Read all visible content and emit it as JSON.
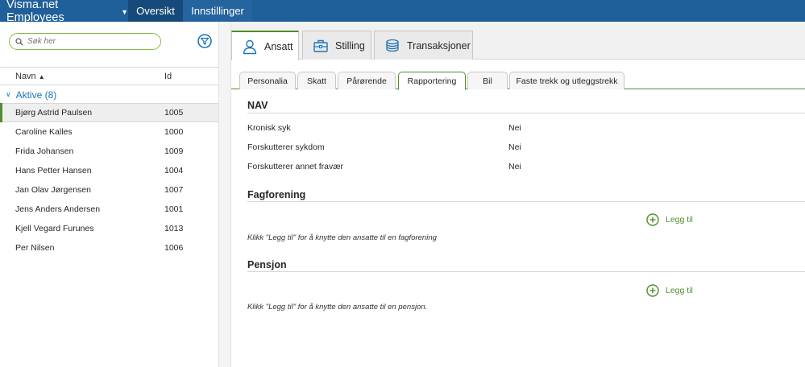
{
  "topbar": {
    "brand": "Visma.net Employees",
    "nav": [
      {
        "label": "Oversikt"
      },
      {
        "label": "Innstillinger"
      }
    ]
  },
  "sidebar": {
    "search_placeholder": "Søk her",
    "columns": {
      "name": "Navn",
      "id": "Id"
    },
    "group_label": "Aktive (8)",
    "employees": [
      {
        "name": "Bjørg Astrid Paulsen",
        "id": "1005"
      },
      {
        "name": "Caroline Kalles",
        "id": "1000"
      },
      {
        "name": "Frida Johansen",
        "id": "1009"
      },
      {
        "name": "Hans Petter Hansen",
        "id": "1004"
      },
      {
        "name": "Jan Olav Jørgensen",
        "id": "1007"
      },
      {
        "name": "Jens Anders Andersen",
        "id": "1001"
      },
      {
        "name": "Kjell Vegard Furunes",
        "id": "1013"
      },
      {
        "name": "Per Nilsen",
        "id": "1006"
      }
    ]
  },
  "main_tabs": [
    {
      "label": "Ansatt",
      "icon": "person-icon"
    },
    {
      "label": "Stilling",
      "icon": "briefcase-icon"
    },
    {
      "label": "Transaksjoner",
      "icon": "coins-icon"
    }
  ],
  "sub_tabs": [
    {
      "label": "Personalia"
    },
    {
      "label": "Skatt"
    },
    {
      "label": "Pårørende"
    },
    {
      "label": "Rapportering"
    },
    {
      "label": "Bil"
    },
    {
      "label": "Faste trekk og utleggstrekk"
    }
  ],
  "nav_section": {
    "title": "NAV",
    "fields": [
      {
        "label": "Kronisk syk",
        "value": "Nei"
      },
      {
        "label": "Forskutterer sykdom",
        "value": "Nei"
      },
      {
        "label": "Forskutterer annet fravær",
        "value": "Nei"
      }
    ]
  },
  "fagforening": {
    "title": "Fagforening",
    "add_label": "Legg til",
    "hint": "Klikk \"Legg til\" for å knytte den ansatte til en fagforening"
  },
  "pensjon": {
    "title": "Pensjon",
    "add_label": "Legg til",
    "hint": "Klikk \"Legg til\" for å knytte den ansatte til en pensjon."
  },
  "colors": {
    "topbar": "#1f5f9a",
    "accent_green": "#4f8e2b",
    "link_blue": "#1b75bb"
  }
}
